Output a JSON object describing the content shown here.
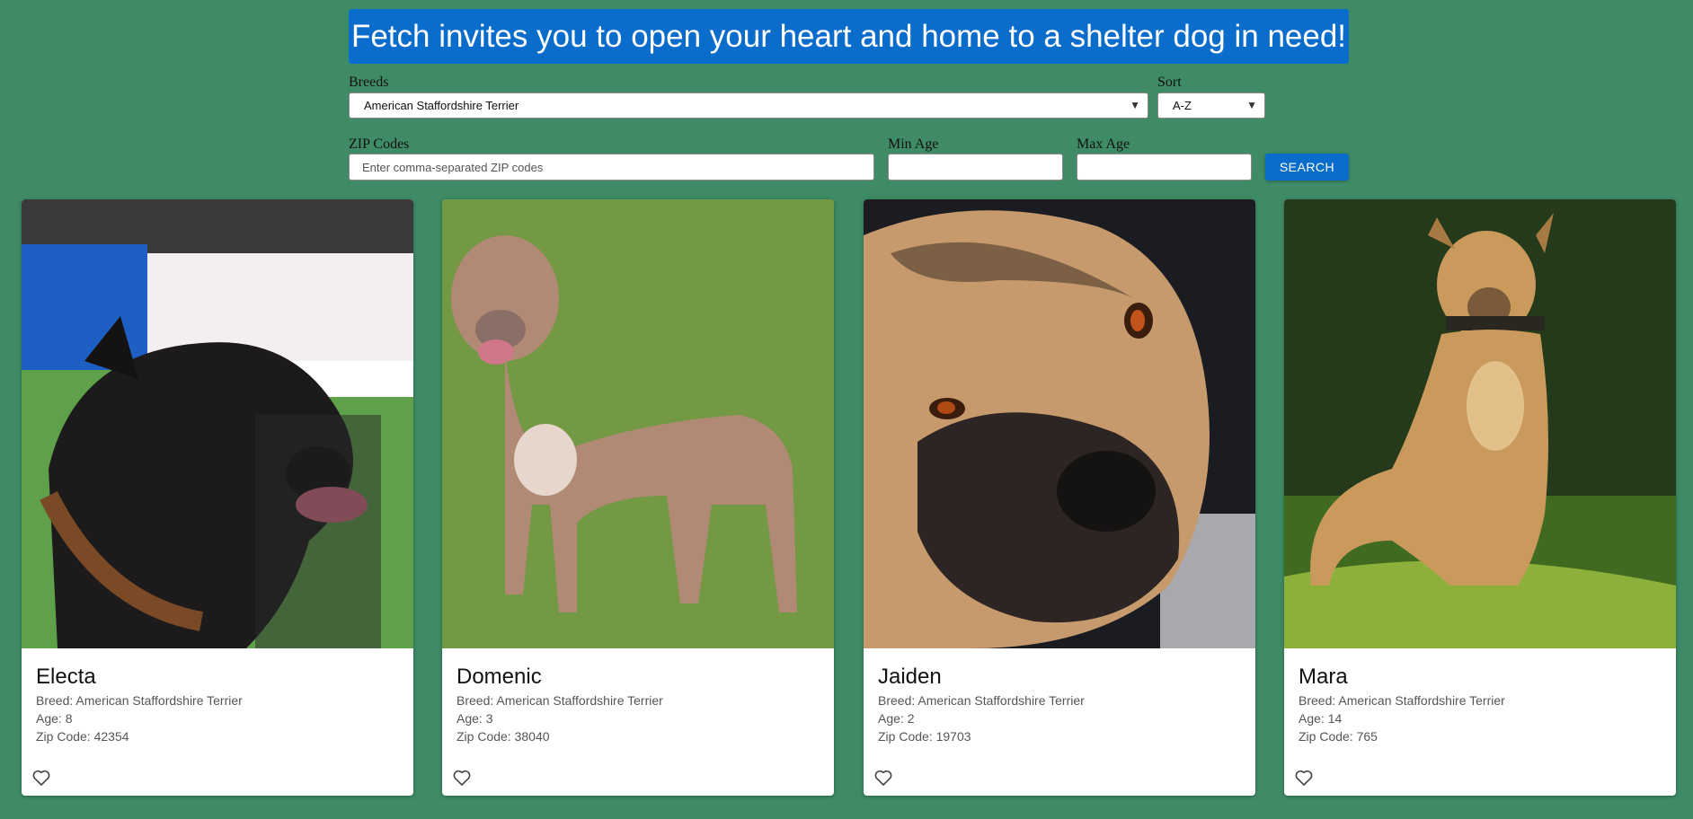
{
  "banner": {
    "text": "Fetch invites you to open your heart and home to a shelter dog in need!"
  },
  "filters": {
    "breeds_label": "Breeds",
    "breeds_value": "American Staffordshire Terrier",
    "sort_label": "Sort",
    "sort_value": "A-Z",
    "zip_label": "ZIP Codes",
    "zip_placeholder": "Enter comma-separated ZIP codes",
    "min_age_label": "Min Age",
    "min_age_value": "",
    "max_age_label": "Max Age",
    "max_age_value": "",
    "search_label": "SEARCH"
  },
  "dogs": [
    {
      "name": "Electa",
      "breed": "Breed: American Staffordshire Terrier",
      "age": "Age: 8",
      "zip": "Zip Code: 42354",
      "coat": "#1c1a1a"
    },
    {
      "name": "Domenic",
      "breed": "Breed: American Staffordshire Terrier",
      "age": "Age: 3",
      "zip": "Zip Code: 38040",
      "coat": "#b08a74"
    },
    {
      "name": "Jaiden",
      "breed": "Breed: American Staffordshire Terrier",
      "age": "Age: 2",
      "zip": "Zip Code: 19703",
      "coat": "#c69a6c"
    },
    {
      "name": "Mara",
      "breed": "Breed: American Staffordshire Terrier",
      "age": "Age: 14",
      "zip": "Zip Code: 765",
      "coat": "#c99a5c"
    }
  ],
  "icons": {
    "favorite": "heart-outline-icon",
    "dropdown": "chevron-down-icon"
  }
}
